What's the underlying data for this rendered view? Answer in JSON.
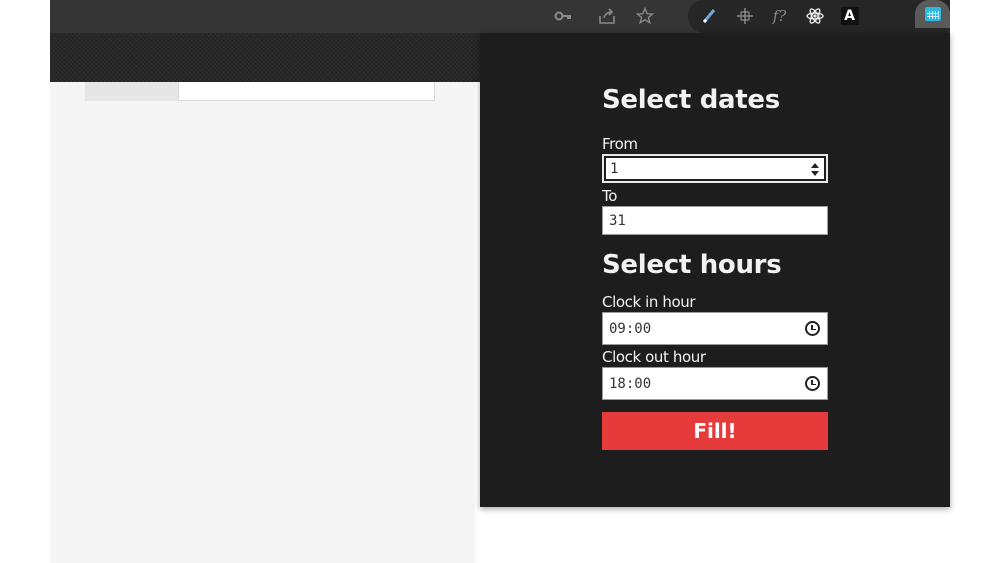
{
  "browser_toolbar": {
    "icons": [
      "key-icon",
      "share-icon",
      "star-icon"
    ],
    "extension_icons": [
      "pencil-icon",
      "crosshair-icon",
      "font-question-icon",
      "react-icon",
      "a-letter-icon",
      "calendar-icon"
    ],
    "extension_glyphs": {
      "a_letter": "A",
      "font_question": "f?"
    }
  },
  "popup": {
    "dates_title": "Select dates",
    "from_label": "From",
    "from_value": "1",
    "to_label": "To",
    "to_value": "31",
    "hours_title": "Select hours",
    "clock_in_label": "Clock in hour",
    "clock_in_value": "09:00",
    "clock_out_label": "Clock out hour",
    "clock_out_value": "18:00",
    "fill_button_label": "Fill!"
  },
  "colors": {
    "popup_background": "#1d1d1d",
    "fill_button": "#e53b3b",
    "active_extension": "#2fb8e0"
  }
}
